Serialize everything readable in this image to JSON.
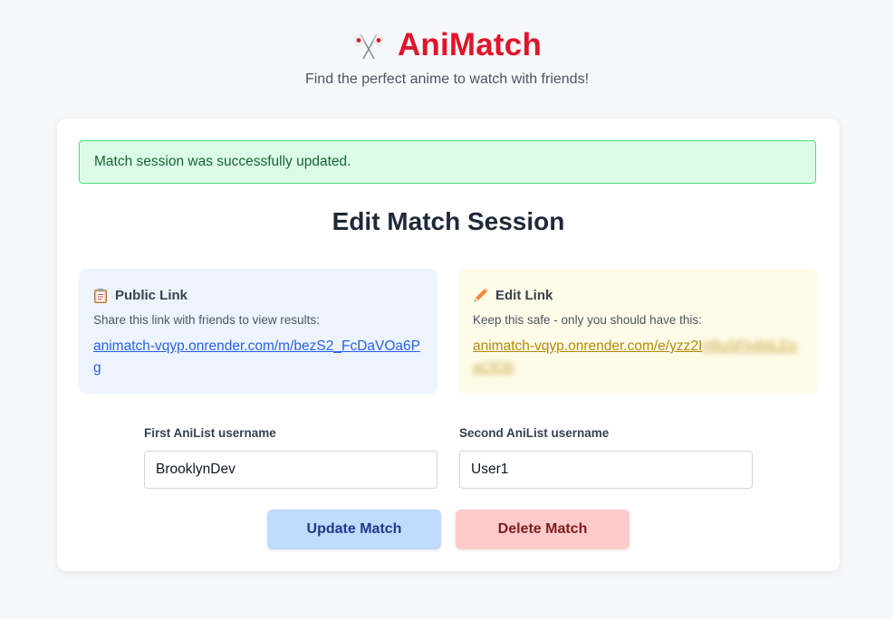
{
  "header": {
    "title": "AniMatch",
    "subtitle": "Find the perfect anime to watch with friends!"
  },
  "alert": {
    "message": "Match session was successfully updated."
  },
  "page_title": "Edit Match Session",
  "public_link": {
    "icon": "clipboard-icon",
    "title": "Public Link",
    "description": "Share this link with friends to view results:",
    "url": "animatch-vqyp.onrender.com/m/bezS2_FcDaVOa6Pg"
  },
  "edit_link": {
    "icon": "pencil-icon",
    "title": "Edit Link",
    "description": "Keep this safe - only you should have this:",
    "url_visible": "animatch-vqyp.onrender.com/e/yzz2I",
    "url_blurred": "H8u5Fh4MLEpaCfO9"
  },
  "form": {
    "first_label": "First AniList username",
    "first_value": "BrooklynDev",
    "second_label": "Second AniList username",
    "second_value": "User1"
  },
  "buttons": {
    "update_label": "Update Match",
    "delete_label": "Delete Match"
  },
  "colors": {
    "brand": "#e0152a",
    "alert_bg": "#dcfce7",
    "public_bg": "#eef4fe",
    "edit_bg": "#fefbe8",
    "update_bg": "#bfdbfe",
    "delete_bg": "#fecaca"
  }
}
